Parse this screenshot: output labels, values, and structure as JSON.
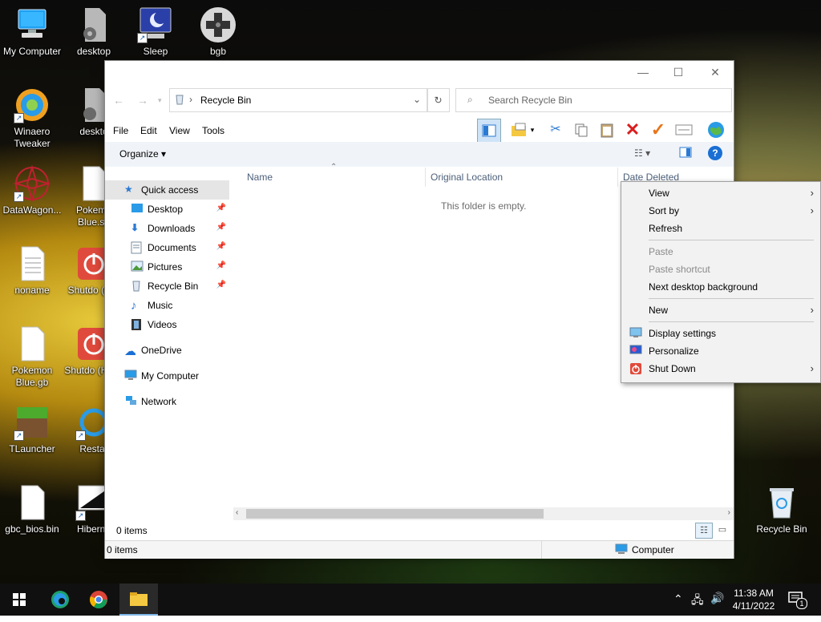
{
  "desktop": {
    "icons": [
      {
        "label": "My Computer"
      },
      {
        "label": "desktop"
      },
      {
        "label": "Sleep"
      },
      {
        "label": "bgb"
      },
      {
        "label": "Winaero Tweaker"
      },
      {
        "label": "deskto"
      },
      {
        "label": "DataWagon..."
      },
      {
        "label": "Pokemo Blue.sa"
      },
      {
        "label": "noname"
      },
      {
        "label": "Shutdo (full)"
      },
      {
        "label": "Pokemon Blue.gb"
      },
      {
        "label": "Shutdo (Hybri"
      },
      {
        "label": "TLauncher"
      },
      {
        "label": "Restar"
      },
      {
        "label": "gbc_bios.bin"
      },
      {
        "label": "Hiberna"
      },
      {
        "label": "Recycle Bin"
      }
    ]
  },
  "explorer": {
    "window_buttons": {
      "minimize": "—",
      "maximize": "☐",
      "close": "✕"
    },
    "address": {
      "path": "Recycle Bin",
      "separator": "›"
    },
    "search": {
      "placeholder": "Search Recycle Bin"
    },
    "menubar": [
      "File",
      "Edit",
      "View",
      "Tools"
    ],
    "organize": "Organize ▾",
    "nav": {
      "quick_access": "Quick access",
      "items": [
        "Desktop",
        "Downloads",
        "Documents",
        "Pictures",
        "Recycle Bin",
        "Music",
        "Videos"
      ],
      "onedrive": "OneDrive",
      "my_computer": "My Computer",
      "network": "Network"
    },
    "columns": {
      "name": "Name",
      "original_location": "Original Location",
      "date_deleted": "Date Deleted"
    },
    "empty_message": "This folder is empty.",
    "items_count": "0 items",
    "status": {
      "items": "0 items",
      "location": "Computer"
    }
  },
  "context_menu": {
    "view": "View",
    "sort_by": "Sort by",
    "refresh": "Refresh",
    "paste": "Paste",
    "paste_shortcut": "Paste shortcut",
    "next_bg": "Next desktop background",
    "new": "New",
    "display_settings": "Display settings",
    "personalize": "Personalize",
    "shut_down": "Shut Down"
  },
  "taskbar": {
    "time": "11:38 AM",
    "date": "4/11/2022",
    "notification_count": "1"
  },
  "colors": {
    "accent": "#0078d7",
    "taskbar": "#101010",
    "cancel_red": "#d81e1e",
    "check_orange": "#e8751a"
  }
}
